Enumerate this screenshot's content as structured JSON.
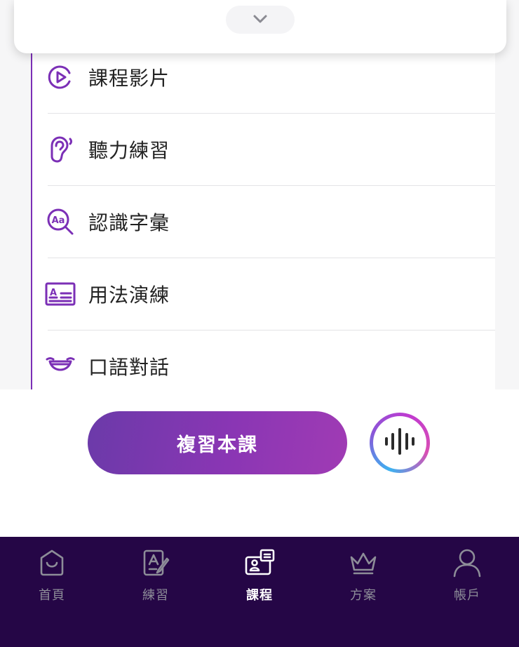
{
  "top_card": {
    "collapse_icon": "chevron-down-icon"
  },
  "lesson_menu": {
    "items": [
      {
        "label": "課程影片",
        "icon": "play-circle-icon"
      },
      {
        "label": "聽力練習",
        "icon": "ear-icon"
      },
      {
        "label": "認識字彙",
        "icon": "vocabulary-magnifier-icon"
      },
      {
        "label": "用法演練",
        "icon": "text-card-icon"
      },
      {
        "label": "口語對話",
        "icon": "smile-mouth-icon"
      }
    ]
  },
  "actions": {
    "review_label": "複習本課",
    "voice_icon": "sound-wave-icon"
  },
  "bottom_nav": {
    "items": [
      {
        "label": "首頁",
        "icon": "home-bag-icon",
        "active": false
      },
      {
        "label": "練習",
        "icon": "practice-pencil-icon",
        "active": false
      },
      {
        "label": "課程",
        "icon": "course-cards-icon",
        "active": true
      },
      {
        "label": "方案",
        "icon": "crown-icon",
        "active": false
      },
      {
        "label": "帳戶",
        "icon": "user-icon",
        "active": false
      }
    ]
  },
  "colors": {
    "accent": "#7b2fb6",
    "nav_background": "#250646",
    "nav_inactive": "#8d8d98",
    "nav_active": "#ffffff"
  }
}
